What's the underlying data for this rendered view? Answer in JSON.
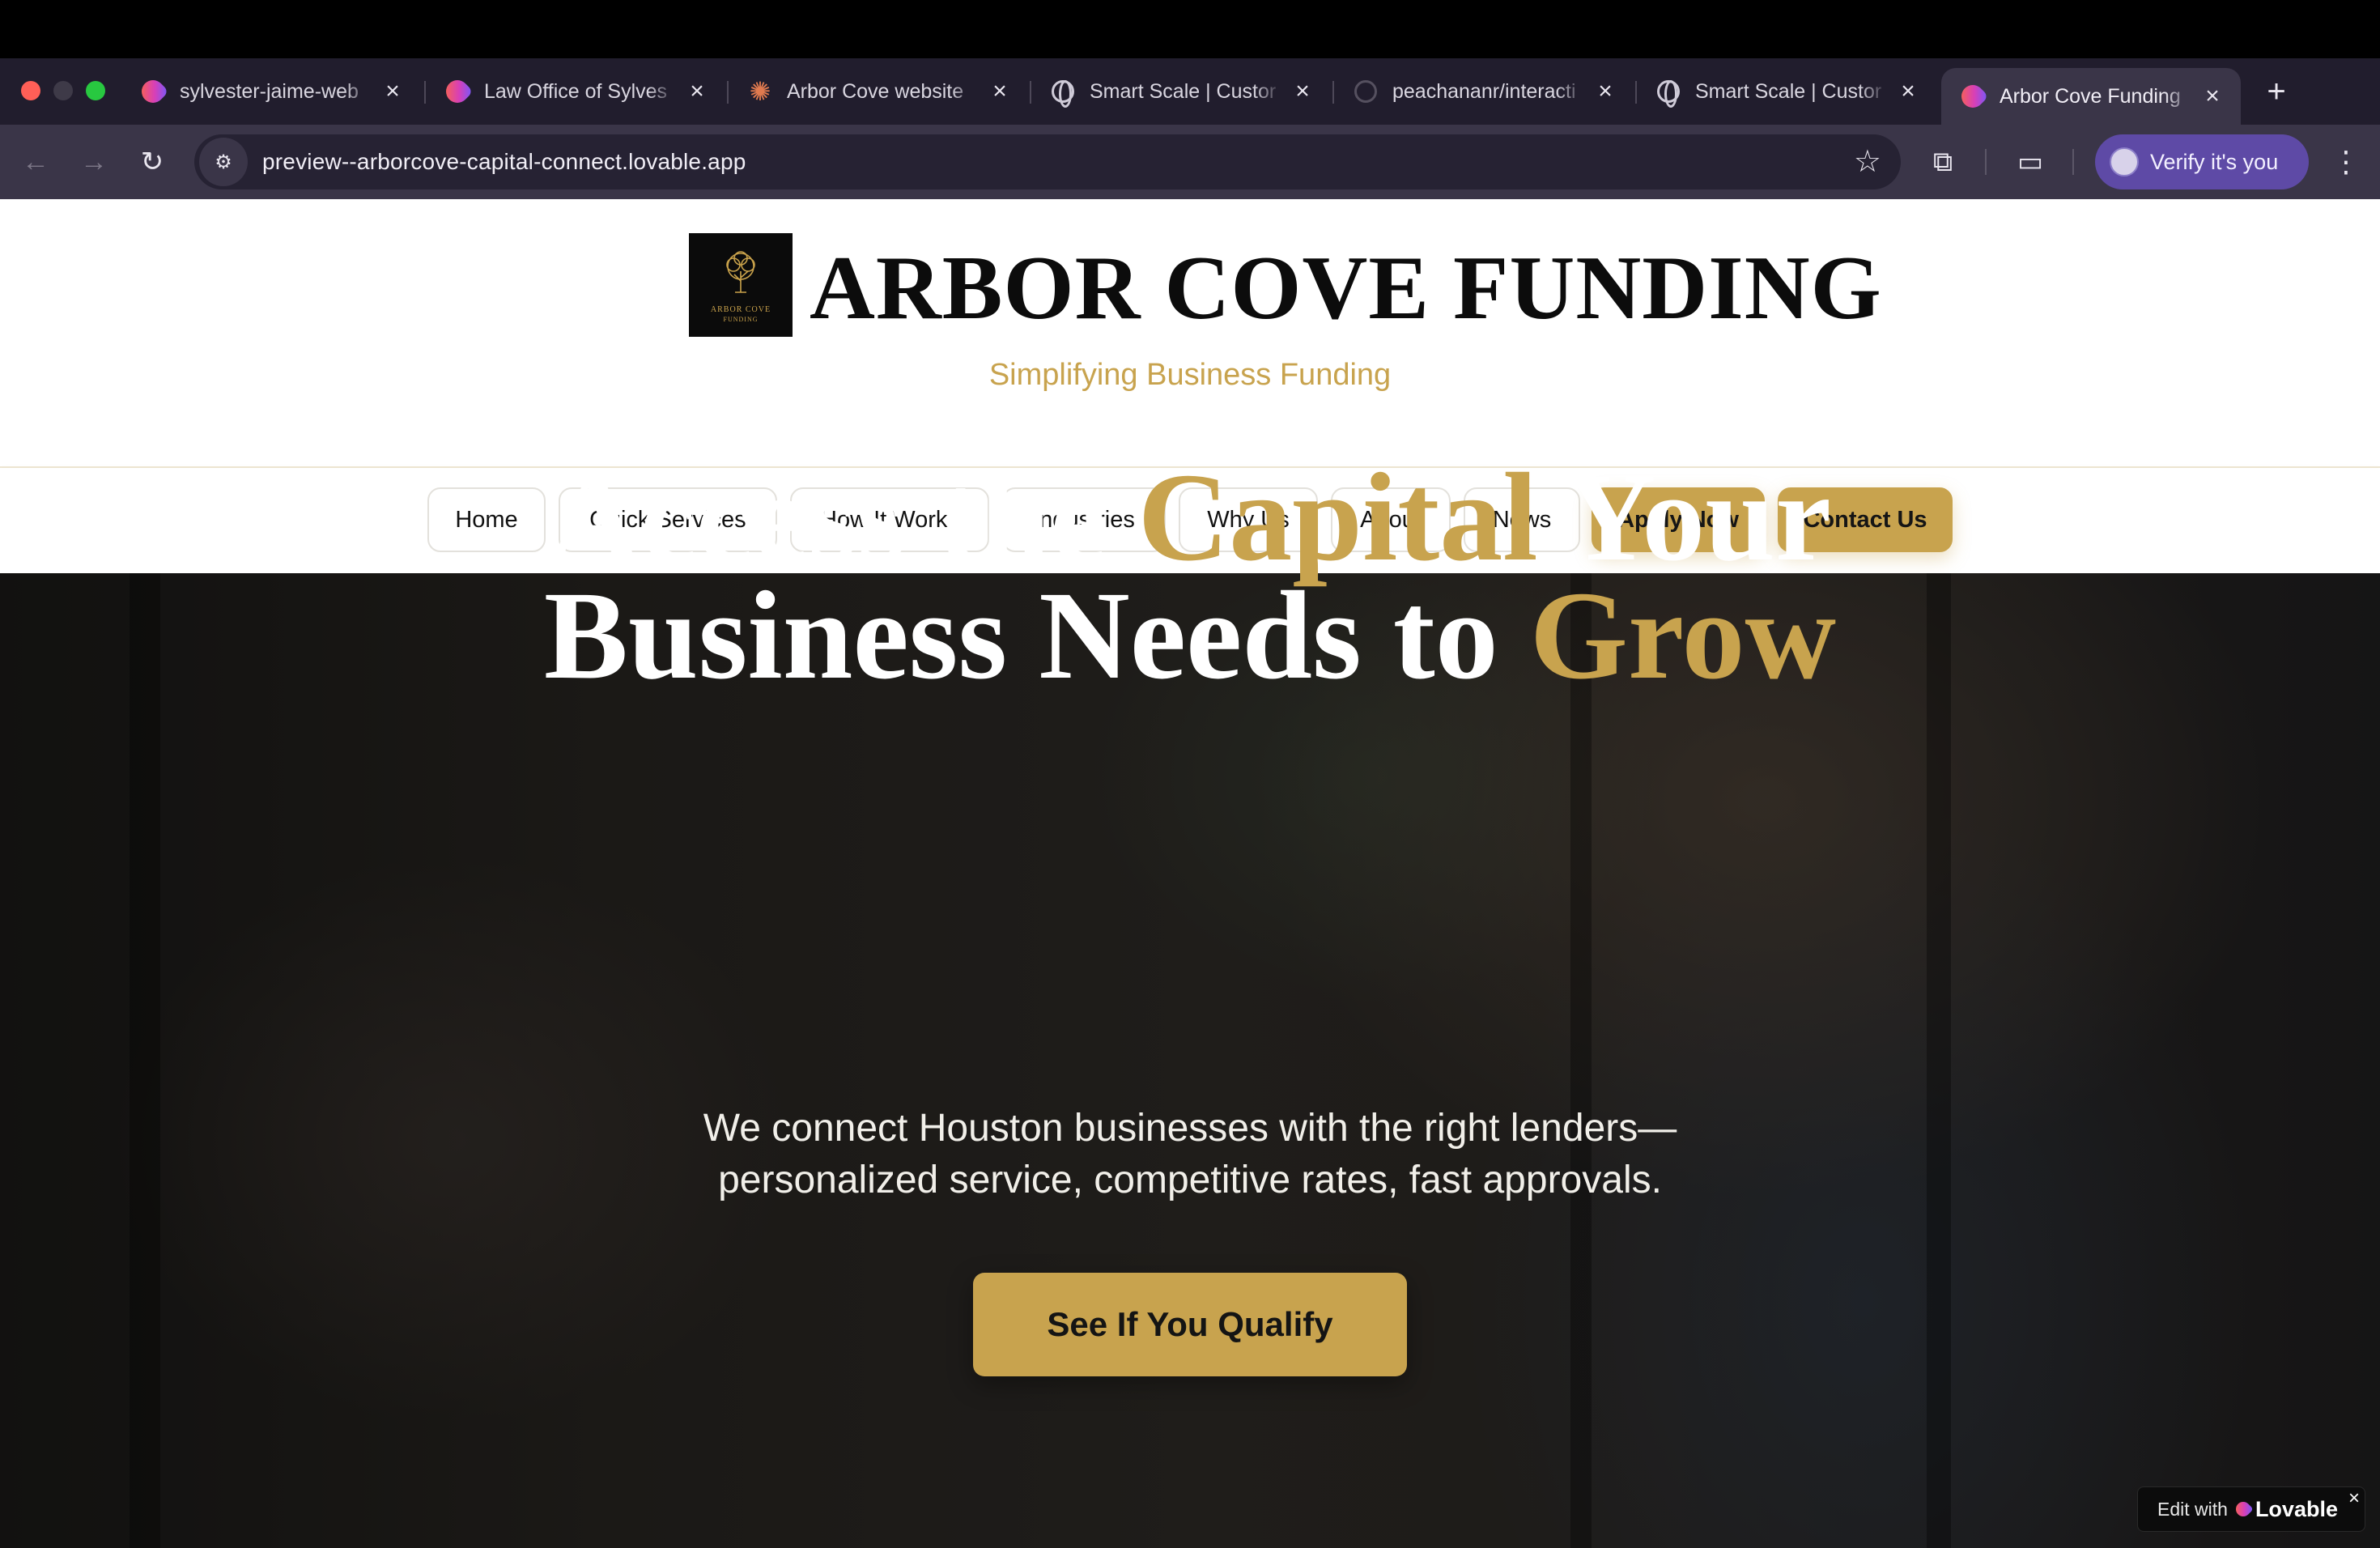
{
  "browser": {
    "tabs": [
      {
        "title": "sylvester-jaime-web",
        "icon": "lovable-heart-icon",
        "active": false
      },
      {
        "title": "Law Office of Sylves",
        "icon": "lovable-heart-icon",
        "active": false
      },
      {
        "title": "Arbor Cove website",
        "icon": "claude-spark-icon",
        "active": false
      },
      {
        "title": "Smart Scale | Custor",
        "icon": "globe-icon",
        "active": false
      },
      {
        "title": "peachananr/interacti",
        "icon": "github-icon",
        "active": false
      },
      {
        "title": "Smart Scale | Custor",
        "icon": "globe-icon",
        "active": false
      },
      {
        "title": "Arbor Cove Funding",
        "icon": "lovable-heart-icon",
        "active": true
      }
    ],
    "url": "preview--arborcove-capital-connect.lovable.app",
    "profile_label": "Verify it's you"
  },
  "brand": {
    "name": "ARBOR COVE FUNDING",
    "tagline": "Simplifying Business Funding",
    "logo_text": "ARBOR COVE",
    "logo_subtext": "FUNDING"
  },
  "nav": {
    "items": [
      "Home",
      "Quick Services",
      "How It Works",
      "Industries",
      "Why Us",
      "About",
      "News"
    ],
    "apply": "Apply Now",
    "contact": "Contact Us"
  },
  "hero": {
    "title_part1": "Access the ",
    "title_gold1": "Capital",
    "title_part2": " Your",
    "title_part3": "Business Needs to ",
    "title_gold2": "Grow",
    "subtitle_line1": "We connect Houston businesses with the right lenders—",
    "subtitle_line2": "personalized service, competitive rates, fast approvals.",
    "cta": "See If You Qualify"
  },
  "badge": {
    "prefix": "Edit with",
    "brand": "Lovable",
    "close": "×"
  },
  "colors": {
    "gold": "#c8a34e",
    "browser_dark": "#211d2d",
    "toolbar": "#3a3548"
  }
}
